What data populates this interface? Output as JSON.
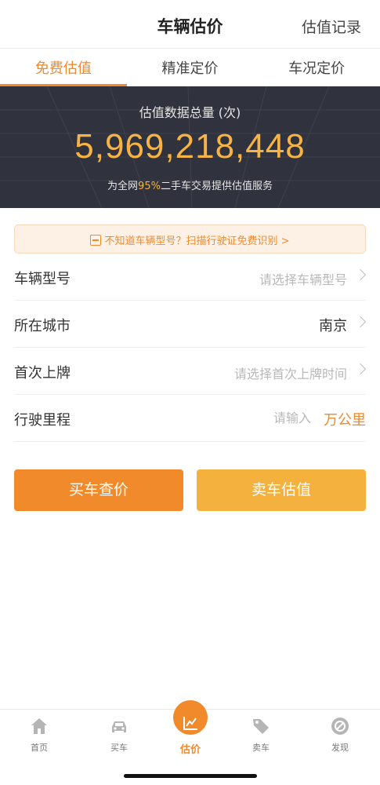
{
  "header": {
    "title": "车辆估价",
    "record_link": "估值记录"
  },
  "tabs": [
    {
      "label": "免费估值",
      "active": true
    },
    {
      "label": "精准定价",
      "active": false
    },
    {
      "label": "车况定价",
      "active": false
    }
  ],
  "banner": {
    "label": "估值数据总量 (次)",
    "count": "5,969,218,448",
    "desc_prefix": "为全网",
    "desc_highlight": "95%",
    "desc_suffix": "二手车交易提供估值服务"
  },
  "scan_tip": {
    "text": "不知道车辆型号？扫描行驶证免费识别 >",
    "icon": "scan-icon"
  },
  "form": {
    "model": {
      "label": "车辆型号",
      "placeholder": "请选择车辆型号"
    },
    "city": {
      "label": "所在城市",
      "value": "南京"
    },
    "registration": {
      "label": "首次上牌",
      "placeholder": "请选择首次上牌时间"
    },
    "mileage": {
      "label": "行驶里程",
      "placeholder": "请输入",
      "unit": "万公里"
    }
  },
  "buttons": {
    "buy": "买车查价",
    "sell": "卖车估值"
  },
  "nav": {
    "items": [
      {
        "label": "首页",
        "icon": "home-icon"
      },
      {
        "label": "买车",
        "icon": "car-icon"
      },
      {
        "label": "估价",
        "icon": "chart-icon",
        "active": true
      },
      {
        "label": "卖车",
        "icon": "tag-icon"
      },
      {
        "label": "发现",
        "icon": "discover-icon"
      }
    ]
  },
  "colors": {
    "accent": "#f08a2b",
    "accent_light": "#f5b13d",
    "banner_bg": "#30333d",
    "number": "#f7b343"
  }
}
